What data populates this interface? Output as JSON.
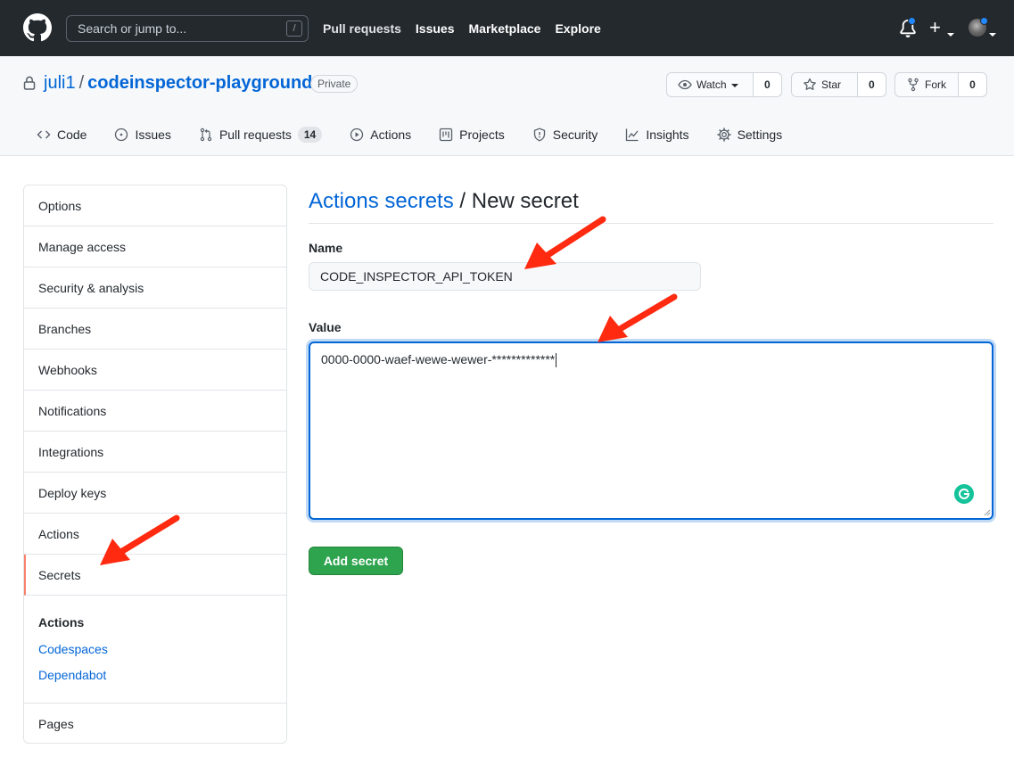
{
  "header": {
    "search_placeholder": "Search or jump to...",
    "search_shortcut": "/",
    "nav": [
      "Pull requests",
      "Issues",
      "Marketplace",
      "Explore"
    ]
  },
  "repo": {
    "owner": "juli1",
    "separator": "/",
    "name": "codeinspector-playground",
    "visibility": "Private",
    "watch_label": "Watch",
    "watch_count": "0",
    "star_label": "Star",
    "star_count": "0",
    "fork_label": "Fork",
    "fork_count": "0"
  },
  "tabs": [
    {
      "label": "Code",
      "icon": "code-icon"
    },
    {
      "label": "Issues",
      "icon": "issue-icon"
    },
    {
      "label": "Pull requests",
      "icon": "pull-request-icon",
      "counter": "14"
    },
    {
      "label": "Actions",
      "icon": "play-icon"
    },
    {
      "label": "Projects",
      "icon": "project-icon"
    },
    {
      "label": "Security",
      "icon": "shield-icon"
    },
    {
      "label": "Insights",
      "icon": "graph-icon"
    },
    {
      "label": "Settings",
      "icon": "gear-icon"
    }
  ],
  "sidebar": {
    "items": [
      "Options",
      "Manage access",
      "Security & analysis",
      "Branches",
      "Webhooks",
      "Notifications",
      "Integrations",
      "Deploy keys",
      "Actions",
      "Secrets"
    ],
    "selected": "Secrets",
    "subheading": "Actions",
    "sublinks": [
      "Codespaces",
      "Dependabot"
    ],
    "last_item": "Pages"
  },
  "main": {
    "breadcrumb_link": "Actions secrets",
    "breadcrumb_current": " / New secret",
    "name_label": "Name",
    "name_value": "CODE_INSPECTOR_API_TOKEN",
    "value_label": "Value",
    "value_text": "0000-0000-waef-wewe-wewer-*************",
    "submit_label": "Add secret"
  },
  "colors": {
    "header_bg": "#24292e",
    "link": "#0366d6",
    "primary_button": "#2ea44f",
    "selected_indicator": "#f9826c",
    "annotation_arrow": "#ff2a10"
  }
}
